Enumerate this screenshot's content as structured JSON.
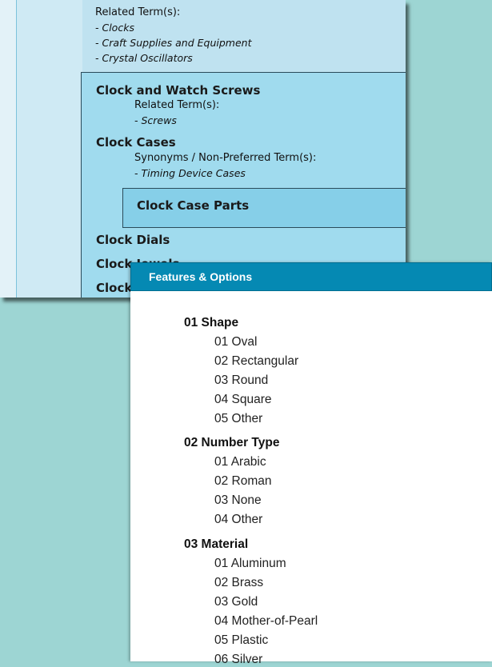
{
  "tree": {
    "top": {
      "related_label": "Related Term(s):",
      "related_items": [
        "- Clocks",
        "- Craft Supplies and Equipment",
        "- Crystal Oscillators"
      ]
    },
    "screws": {
      "title": "Clock and Watch Screws",
      "related_label": "Related Term(s):",
      "related_item": "- Screws"
    },
    "cases": {
      "title": "Clock Cases",
      "synonyms_label": "Synonyms / Non-Preferred Term(s):",
      "synonym_item": "- Timing Device Cases"
    },
    "case_parts": {
      "title": "Clock Case Parts"
    },
    "dials": {
      "title": "Clock Dials"
    },
    "partial_items": [
      "Clock Jewels",
      "Clock"
    ]
  },
  "popup": {
    "header": "Features & Options",
    "groups": [
      {
        "title": "01 Shape",
        "options": [
          "01 Oval",
          "02 Rectangular",
          "03 Round",
          "04 Square",
          "05 Other"
        ]
      },
      {
        "title": "02 Number Type",
        "options": [
          "01 Arabic",
          "02 Roman",
          "03 None",
          "04 Other"
        ]
      },
      {
        "title": "03 Material",
        "options": [
          "01 Aluminum",
          "02 Brass",
          "03 Gold",
          "04 Mother-of-Pearl",
          "05 Plastic",
          "06 Silver"
        ]
      }
    ]
  },
  "colors": {
    "background": "#9dd5d3",
    "popup_header": "#0589b3",
    "panel": "#a0dbee",
    "selected_panel": "#86cfe8"
  }
}
